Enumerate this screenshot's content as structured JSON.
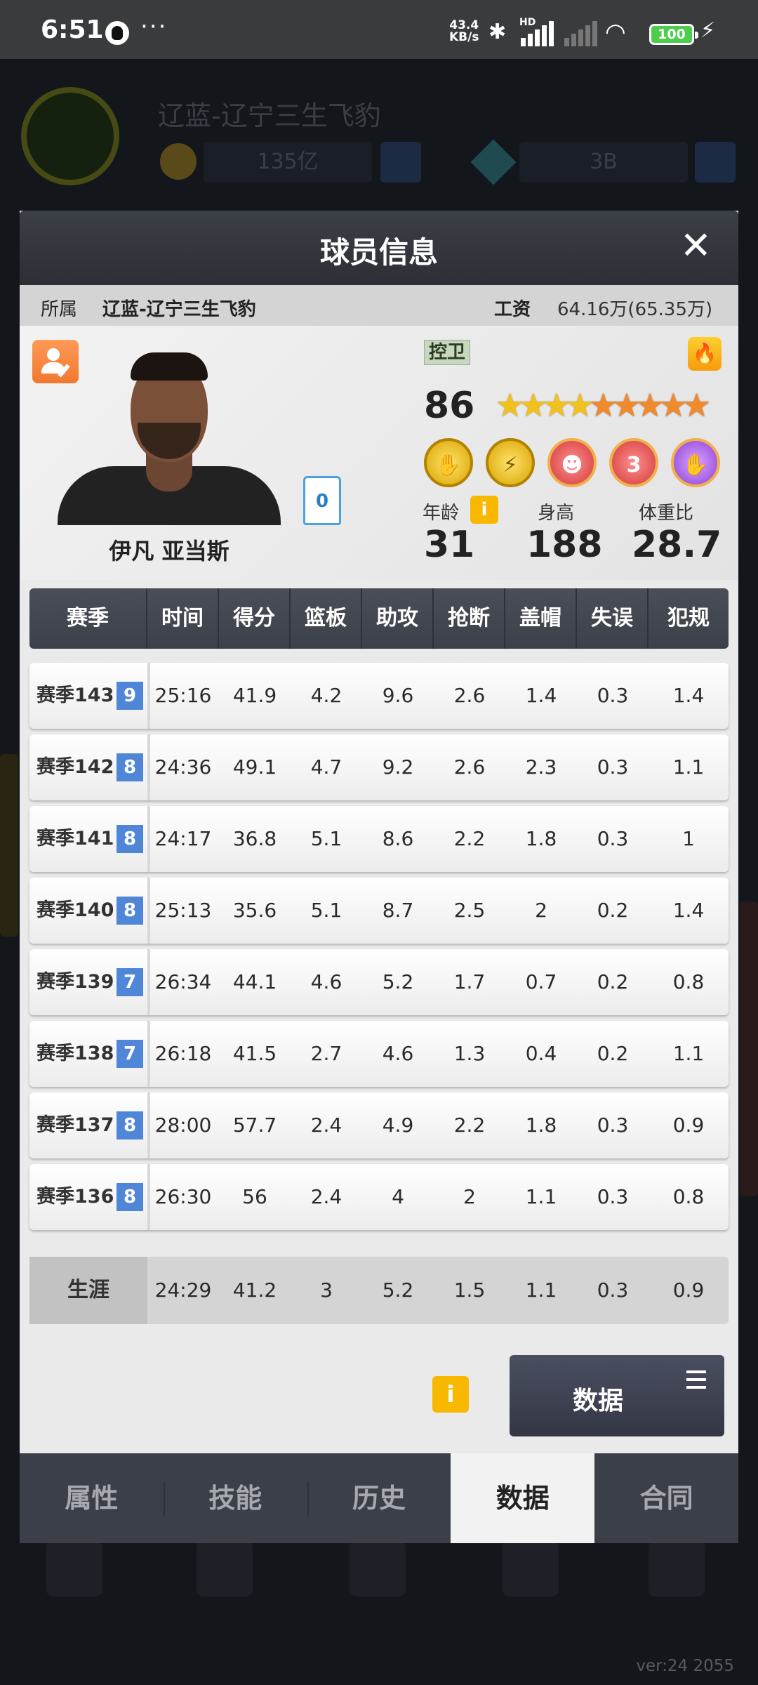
{
  "status_bar": {
    "time": "6:51",
    "more": "···",
    "net_speed_value": "43.4",
    "net_speed_unit": "KB/s",
    "hd_label": "HD",
    "battery": "100"
  },
  "background": {
    "team_name": "辽蓝-辽宁三生飞豹",
    "currency1": "135亿",
    "currency2": "3B",
    "version": "ver:24  2055"
  },
  "modal": {
    "title": "球员信息",
    "affiliation_label": "所属",
    "affiliation_value": "辽蓝-辽宁三生飞豹",
    "salary_label": "工资",
    "salary_value": "64.16万(65.35万)",
    "player": {
      "name": "伊凡 亚当斯",
      "jersey_number": "0",
      "position": "控卫",
      "rating": "86",
      "stars_gold": 4,
      "stars_orange": 5,
      "badges": [
        {
          "icon": "hand-badge-icon",
          "color": "yellow",
          "glyph": "✋"
        },
        {
          "icon": "lightning-badge-icon",
          "color": "yellow",
          "glyph": "⚡"
        },
        {
          "icon": "brain-badge-icon",
          "color": "red",
          "glyph": "☻"
        },
        {
          "icon": "three-point-badge-icon",
          "color": "red",
          "glyph": "3"
        },
        {
          "icon": "shooting-hand-badge-icon",
          "color": "purple",
          "glyph": "✋"
        }
      ],
      "age_label": "年龄",
      "age": "31",
      "height_label": "身高",
      "height": "188",
      "weight_ratio_label": "体重比",
      "weight_ratio": "28.7"
    },
    "table": {
      "headers": [
        "赛季",
        "时间",
        "得分",
        "篮板",
        "助攻",
        "抢断",
        "盖帽",
        "失误",
        "犯规"
      ],
      "rows": [
        {
          "season": "赛季143",
          "level": "9",
          "stats": [
            "25:16",
            "41.9",
            "4.2",
            "9.6",
            "2.6",
            "1.4",
            "0.3",
            "1.4"
          ]
        },
        {
          "season": "赛季142",
          "level": "8",
          "stats": [
            "24:36",
            "49.1",
            "4.7",
            "9.2",
            "2.6",
            "2.3",
            "0.3",
            "1.1"
          ]
        },
        {
          "season": "赛季141",
          "level": "8",
          "stats": [
            "24:17",
            "36.8",
            "5.1",
            "8.6",
            "2.2",
            "1.8",
            "0.3",
            "1"
          ]
        },
        {
          "season": "赛季140",
          "level": "8",
          "stats": [
            "25:13",
            "35.6",
            "5.1",
            "8.7",
            "2.5",
            "2",
            "0.2",
            "1.4"
          ]
        },
        {
          "season": "赛季139",
          "level": "7",
          "stats": [
            "26:34",
            "44.1",
            "4.6",
            "5.2",
            "1.7",
            "0.7",
            "0.2",
            "0.8"
          ]
        },
        {
          "season": "赛季138",
          "level": "7",
          "stats": [
            "26:18",
            "41.5",
            "2.7",
            "4.6",
            "1.3",
            "0.4",
            "0.2",
            "1.1"
          ]
        },
        {
          "season": "赛季137",
          "level": "8",
          "stats": [
            "28:00",
            "57.7",
            "2.4",
            "4.9",
            "2.2",
            "1.8",
            "0.3",
            "0.9"
          ]
        },
        {
          "season": "赛季136",
          "level": "8",
          "stats": [
            "26:30",
            "56",
            "2.4",
            "4",
            "2",
            "1.1",
            "0.3",
            "0.8"
          ]
        }
      ],
      "career": {
        "label": "生涯",
        "stats": [
          "24:29",
          "41.2",
          "3",
          "5.2",
          "1.5",
          "1.1",
          "0.3",
          "0.9"
        ]
      }
    },
    "data_button_label": "数据",
    "tabs": [
      "属性",
      "技能",
      "历史",
      "数据",
      "合同"
    ],
    "active_tab": "数据"
  }
}
